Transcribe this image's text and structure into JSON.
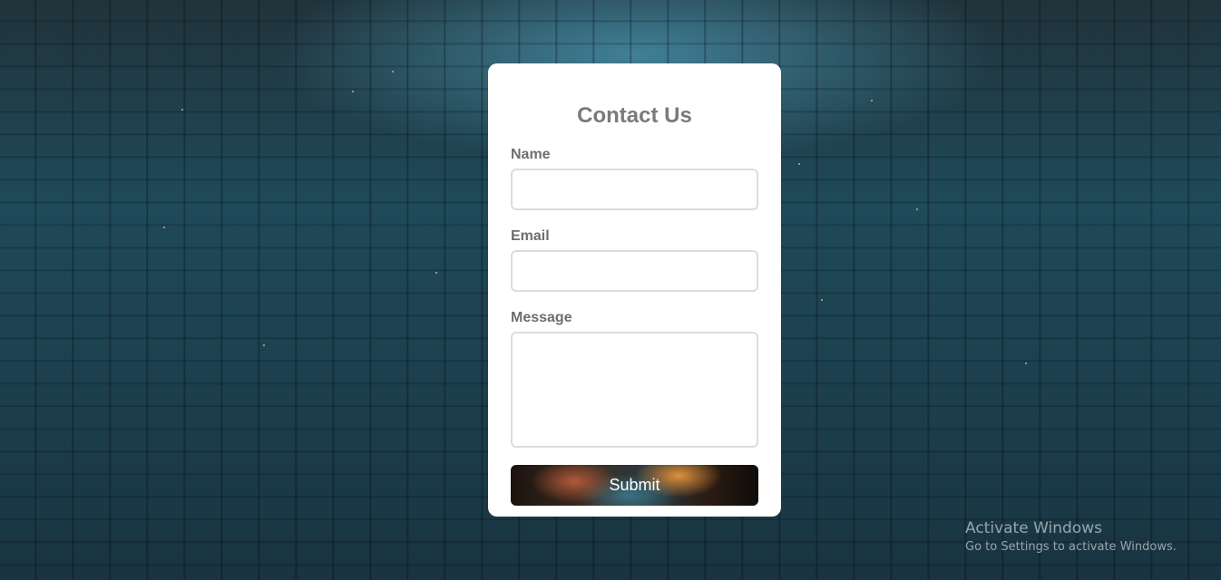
{
  "form": {
    "title": "Contact Us",
    "name_label": "Name",
    "name_value": "",
    "email_label": "Email",
    "email_value": "",
    "message_label": "Message",
    "message_value": "",
    "submit_label": "Submit"
  },
  "watermark": {
    "title": "Activate Windows",
    "subtitle": "Go to Settings to activate Windows."
  },
  "colors": {
    "card_background": "#ffffff",
    "label_text": "#6e6e6e",
    "field_border": "#dcdcdc",
    "button_text": "#ffffff"
  }
}
